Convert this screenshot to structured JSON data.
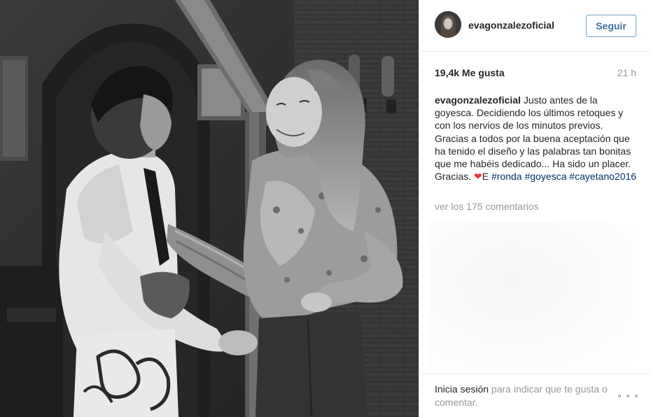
{
  "post": {
    "photo_description_icon": "post-photo",
    "username": "evagonzalezoficial",
    "follow_label": "Seguir",
    "likes": "19,4k Me gusta",
    "time": "21 h",
    "caption": {
      "user": "evagonzalezoficial",
      "text_1": " Justo antes de la goyesca. Decidiendo los últimos retoques y con los nervios de los minutos previos. Gracias a todos por la buena aceptación que ha tenido el diseño y las palabras tan bonitas que me habéis dedicado... Ha sido un placer. Gracias. ",
      "heart": "❤",
      "text_2": "E ",
      "hashtags": [
        "#ronda",
        "#goyesca",
        "#cayetano2016"
      ]
    },
    "view_comments": "ver los 175 comentarios",
    "footer": {
      "login_link": "Inicia sesión",
      "login_rest": " para indicar que te gusta o comentar."
    },
    "more_icon": "more-options-icon"
  },
  "colors": {
    "link_blue": "#003569",
    "follow_blue": "#3f729b",
    "muted_gray": "#999999",
    "text": "#262626",
    "heart_red": "#e0383e"
  }
}
